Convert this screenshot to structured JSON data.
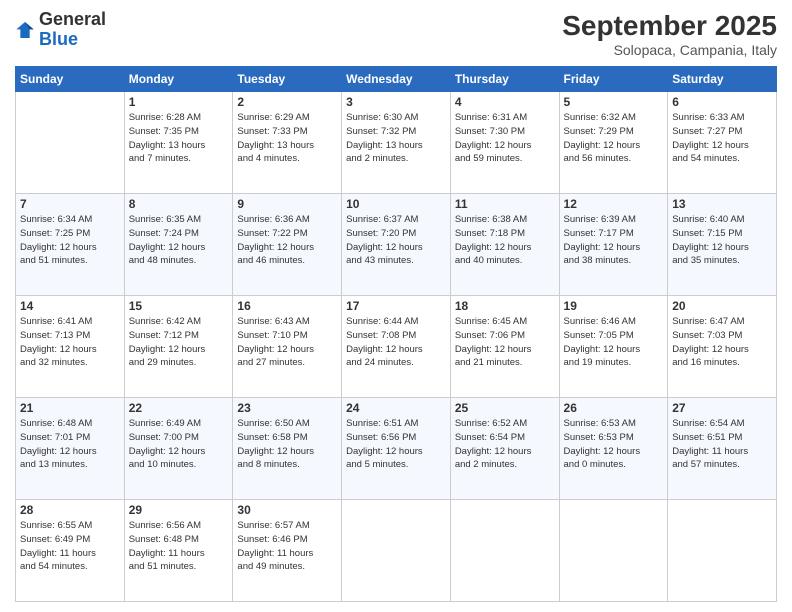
{
  "logo": {
    "general": "General",
    "blue": "Blue"
  },
  "header": {
    "month": "September 2025",
    "location": "Solopaca, Campania, Italy"
  },
  "days_of_week": [
    "Sunday",
    "Monday",
    "Tuesday",
    "Wednesday",
    "Thursday",
    "Friday",
    "Saturday"
  ],
  "weeks": [
    [
      {
        "num": "",
        "info": ""
      },
      {
        "num": "1",
        "info": "Sunrise: 6:28 AM\nSunset: 7:35 PM\nDaylight: 13 hours\nand 7 minutes."
      },
      {
        "num": "2",
        "info": "Sunrise: 6:29 AM\nSunset: 7:33 PM\nDaylight: 13 hours\nand 4 minutes."
      },
      {
        "num": "3",
        "info": "Sunrise: 6:30 AM\nSunset: 7:32 PM\nDaylight: 13 hours\nand 2 minutes."
      },
      {
        "num": "4",
        "info": "Sunrise: 6:31 AM\nSunset: 7:30 PM\nDaylight: 12 hours\nand 59 minutes."
      },
      {
        "num": "5",
        "info": "Sunrise: 6:32 AM\nSunset: 7:29 PM\nDaylight: 12 hours\nand 56 minutes."
      },
      {
        "num": "6",
        "info": "Sunrise: 6:33 AM\nSunset: 7:27 PM\nDaylight: 12 hours\nand 54 minutes."
      }
    ],
    [
      {
        "num": "7",
        "info": "Sunrise: 6:34 AM\nSunset: 7:25 PM\nDaylight: 12 hours\nand 51 minutes."
      },
      {
        "num": "8",
        "info": "Sunrise: 6:35 AM\nSunset: 7:24 PM\nDaylight: 12 hours\nand 48 minutes."
      },
      {
        "num": "9",
        "info": "Sunrise: 6:36 AM\nSunset: 7:22 PM\nDaylight: 12 hours\nand 46 minutes."
      },
      {
        "num": "10",
        "info": "Sunrise: 6:37 AM\nSunset: 7:20 PM\nDaylight: 12 hours\nand 43 minutes."
      },
      {
        "num": "11",
        "info": "Sunrise: 6:38 AM\nSunset: 7:18 PM\nDaylight: 12 hours\nand 40 minutes."
      },
      {
        "num": "12",
        "info": "Sunrise: 6:39 AM\nSunset: 7:17 PM\nDaylight: 12 hours\nand 38 minutes."
      },
      {
        "num": "13",
        "info": "Sunrise: 6:40 AM\nSunset: 7:15 PM\nDaylight: 12 hours\nand 35 minutes."
      }
    ],
    [
      {
        "num": "14",
        "info": "Sunrise: 6:41 AM\nSunset: 7:13 PM\nDaylight: 12 hours\nand 32 minutes."
      },
      {
        "num": "15",
        "info": "Sunrise: 6:42 AM\nSunset: 7:12 PM\nDaylight: 12 hours\nand 29 minutes."
      },
      {
        "num": "16",
        "info": "Sunrise: 6:43 AM\nSunset: 7:10 PM\nDaylight: 12 hours\nand 27 minutes."
      },
      {
        "num": "17",
        "info": "Sunrise: 6:44 AM\nSunset: 7:08 PM\nDaylight: 12 hours\nand 24 minutes."
      },
      {
        "num": "18",
        "info": "Sunrise: 6:45 AM\nSunset: 7:06 PM\nDaylight: 12 hours\nand 21 minutes."
      },
      {
        "num": "19",
        "info": "Sunrise: 6:46 AM\nSunset: 7:05 PM\nDaylight: 12 hours\nand 19 minutes."
      },
      {
        "num": "20",
        "info": "Sunrise: 6:47 AM\nSunset: 7:03 PM\nDaylight: 12 hours\nand 16 minutes."
      }
    ],
    [
      {
        "num": "21",
        "info": "Sunrise: 6:48 AM\nSunset: 7:01 PM\nDaylight: 12 hours\nand 13 minutes."
      },
      {
        "num": "22",
        "info": "Sunrise: 6:49 AM\nSunset: 7:00 PM\nDaylight: 12 hours\nand 10 minutes."
      },
      {
        "num": "23",
        "info": "Sunrise: 6:50 AM\nSunset: 6:58 PM\nDaylight: 12 hours\nand 8 minutes."
      },
      {
        "num": "24",
        "info": "Sunrise: 6:51 AM\nSunset: 6:56 PM\nDaylight: 12 hours\nand 5 minutes."
      },
      {
        "num": "25",
        "info": "Sunrise: 6:52 AM\nSunset: 6:54 PM\nDaylight: 12 hours\nand 2 minutes."
      },
      {
        "num": "26",
        "info": "Sunrise: 6:53 AM\nSunset: 6:53 PM\nDaylight: 12 hours\nand 0 minutes."
      },
      {
        "num": "27",
        "info": "Sunrise: 6:54 AM\nSunset: 6:51 PM\nDaylight: 11 hours\nand 57 minutes."
      }
    ],
    [
      {
        "num": "28",
        "info": "Sunrise: 6:55 AM\nSunset: 6:49 PM\nDaylight: 11 hours\nand 54 minutes."
      },
      {
        "num": "29",
        "info": "Sunrise: 6:56 AM\nSunset: 6:48 PM\nDaylight: 11 hours\nand 51 minutes."
      },
      {
        "num": "30",
        "info": "Sunrise: 6:57 AM\nSunset: 6:46 PM\nDaylight: 11 hours\nand 49 minutes."
      },
      {
        "num": "",
        "info": ""
      },
      {
        "num": "",
        "info": ""
      },
      {
        "num": "",
        "info": ""
      },
      {
        "num": "",
        "info": ""
      }
    ]
  ]
}
